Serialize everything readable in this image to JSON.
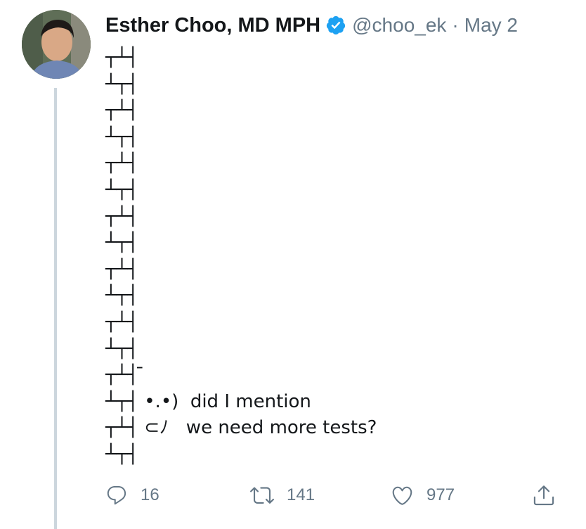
{
  "tweet": {
    "author": {
      "display_name": "Esther Choo, MD MPH",
      "verified": true,
      "handle": "@choo_ek",
      "avatar_icon": "profile-photo"
    },
    "separator": "·",
    "date": "May 2",
    "text": "┬┴┤\n┴┬┤\n┬┴┤\n┴┬┤\n┬┴┤\n┴┬┤\n┬┴┤\n┴┬┤\n┬┴┤\n┴┬┤\n┬┴┤\n┴┬┤\n┬┴┤ ̄\n┴┬┤ •.•)  did I mention\n┬┴┤ ⊂ﾉ   we need more tests?\n┴┬┤",
    "actions": {
      "reply": {
        "icon": "reply-icon",
        "count": "16"
      },
      "retweet": {
        "icon": "retweet-icon",
        "count": "141"
      },
      "like": {
        "icon": "heart-icon",
        "count": "977"
      },
      "share": {
        "icon": "share-icon"
      }
    }
  },
  "colors": {
    "text_primary": "#14171a",
    "text_secondary": "#657786",
    "verified_blue": "#1da1f2",
    "thread_line": "#ccd6dd"
  }
}
